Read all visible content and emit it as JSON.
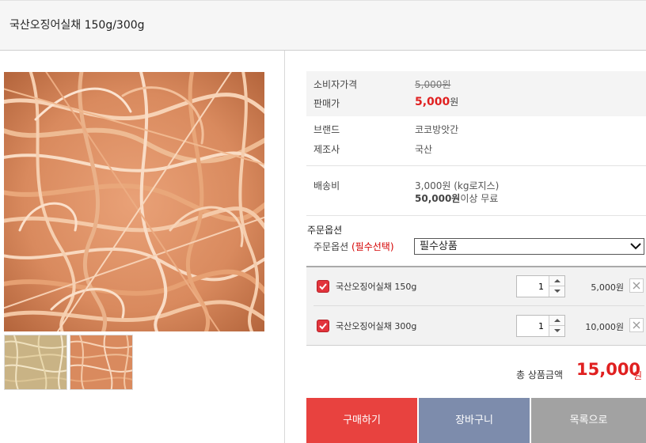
{
  "product": {
    "title": "국산오징어실채 150g/300g"
  },
  "images": {
    "main": "dried-squid-strips-photo",
    "thumbnails": [
      "dried-squid-light-thumb",
      "dried-squid-orange-thumb"
    ]
  },
  "price": {
    "consumer_label": "소비자가격",
    "consumer_value": "5,000원",
    "sale_label": "판매가",
    "sale_value": "5,000",
    "sale_unit": "원"
  },
  "info": {
    "brand_label": "브랜드",
    "brand_value": "코코방앗간",
    "maker_label": "제조사",
    "maker_value": "국산",
    "shipping_label": "배송비",
    "shipping_value": "3,000원 (kg로지스)",
    "shipping_free_amount": "50,000원",
    "shipping_free_text": "이상 무료"
  },
  "options": {
    "section_title": "주문옵션",
    "label": "주문옵션",
    "required_tag": "(필수선택)",
    "select_value": "필수상품",
    "items": [
      {
        "name": "국산오징어실채 150g",
        "qty": "1",
        "price": "5,000원"
      },
      {
        "name": "국산오징어실채 300g",
        "qty": "1",
        "price": "10,000원"
      }
    ]
  },
  "total": {
    "label": "총 상품금액",
    "value": "15,000",
    "unit": "원"
  },
  "buttons": {
    "buy": "구매하기",
    "cart": "장바구니",
    "list": "목록으로"
  },
  "colors": {
    "accent_red": "#e02020",
    "buy_button": "#e8423f",
    "cart_button": "#7d8cac",
    "list_button": "#a2a2a2"
  }
}
